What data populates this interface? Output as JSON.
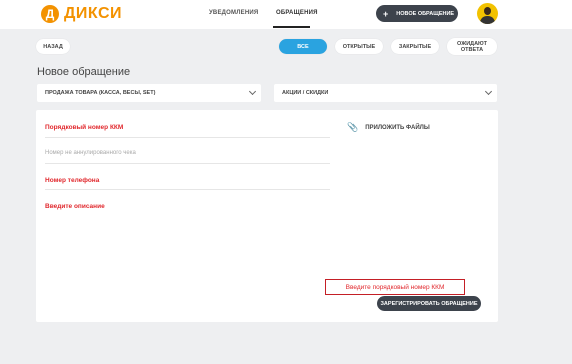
{
  "brand": {
    "logo_letter": "Д",
    "name": "ДИКСИ",
    "color": "#f39200"
  },
  "nav": {
    "notifications": "УВЕДОМЛЕНИЯ",
    "requests": "ОБРАЩЕНИЯ",
    "active": "ОБРАЩЕНИЯ"
  },
  "header": {
    "new_request": "НОВОЕ ОБРАЩЕНИЕ",
    "new_icon": "+",
    "avatar_icon": "user-avatar-icon"
  },
  "toolbar": {
    "back": "НАЗАД",
    "filters": [
      {
        "label": "ВСЕ",
        "active": true
      },
      {
        "label": "ОТКРЫТЫЕ",
        "active": false
      },
      {
        "label": "ЗАКРЫТЫЕ",
        "active": false
      },
      {
        "label_line1": "ОЖИДАЮТ",
        "label_line2": "ОТВЕТА",
        "active": false
      }
    ]
  },
  "page": {
    "title": "Новое обращение"
  },
  "selects": {
    "category": "ПРОДАЖА ТОВАРА (КАССА, ВЕСЫ, SET)",
    "subcategory": "АКЦИИ / СКИДКИ"
  },
  "form": {
    "kkm_label": "Порядковый номер ККМ",
    "kkm_placeholder": "Номер не аннулированного чека",
    "phone_label": "Номер телефона",
    "description_label": "Введите описание",
    "attach_label": "ПРИЛОЖИТЬ ФАЙЛЫ",
    "error_message": "Введите порядковый номер ККМ",
    "submit": "ЗАРЕГИСТРИРОВАТЬ ОБРАЩЕНИЕ"
  },
  "colors": {
    "accent": "#2aa3e0",
    "error": "#e1282d",
    "dark_button": "#3d434c",
    "background": "#eeeff1"
  }
}
